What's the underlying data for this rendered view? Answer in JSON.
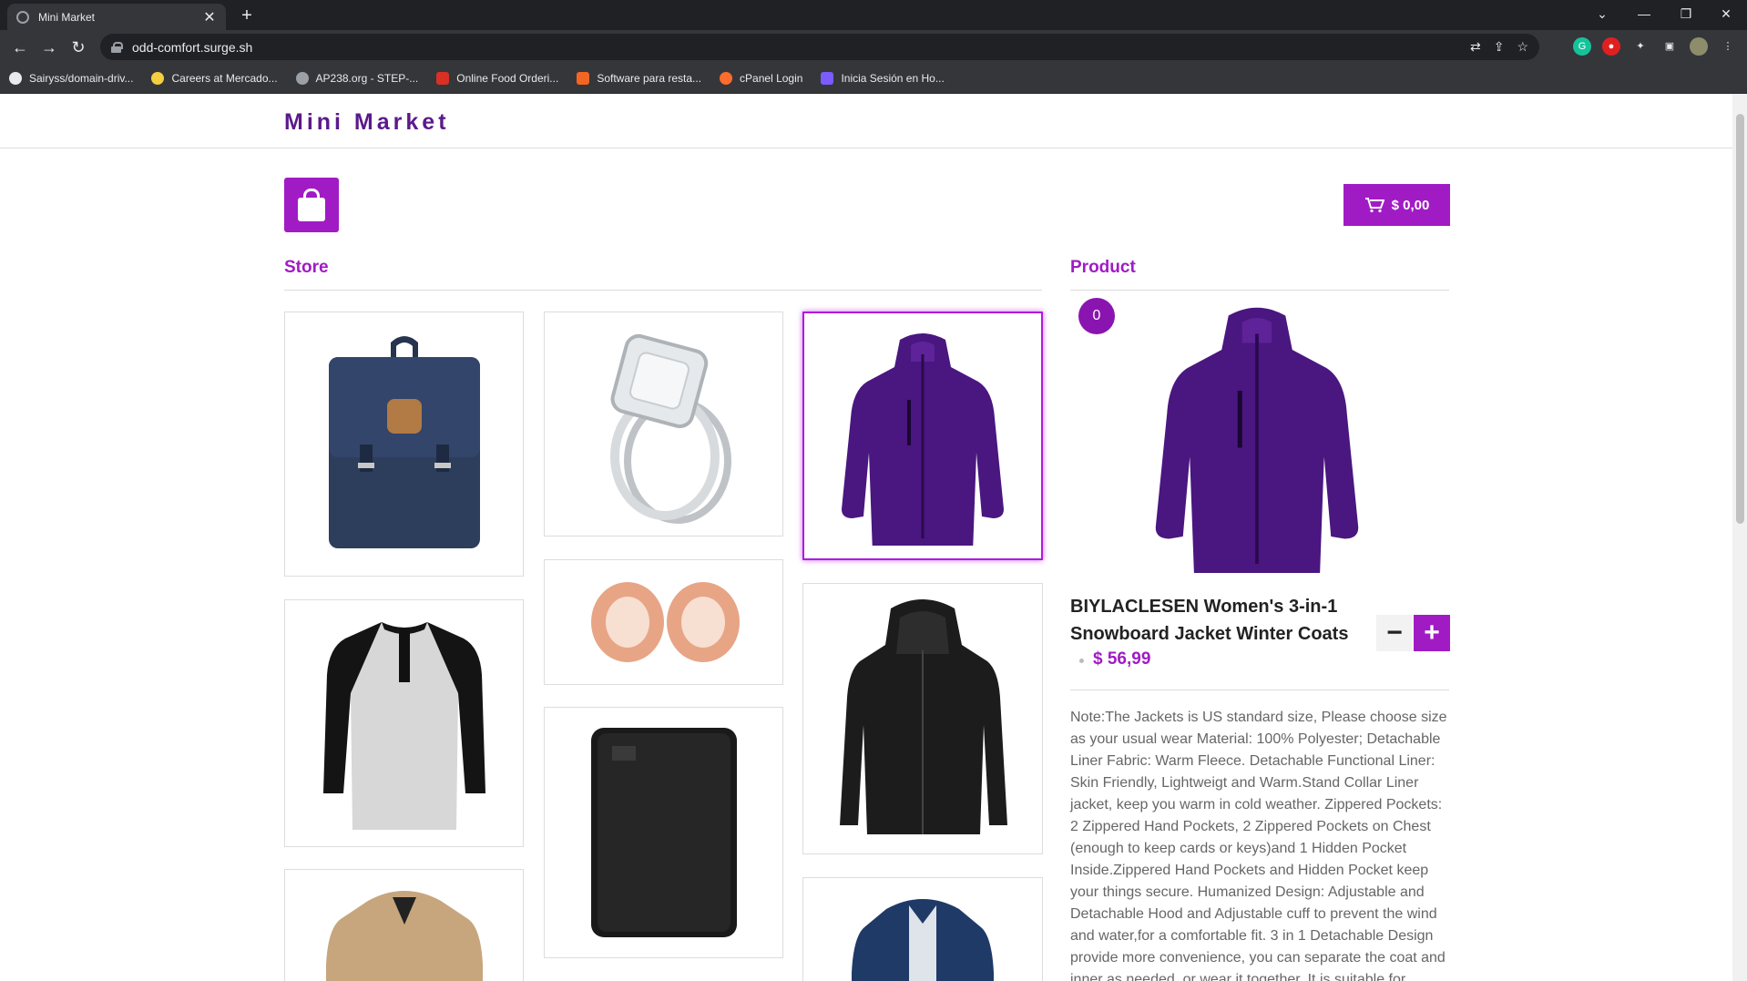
{
  "browser": {
    "tab_title": "Mini Market",
    "url": "odd-comfort.surge.sh",
    "bookmarks": [
      {
        "label": "Sairyss/domain-driv...",
        "color": "#e8eaed"
      },
      {
        "label": "Careers at Mercado...",
        "color": "#f4d03f"
      },
      {
        "label": "AP238.org - STEP-...",
        "color": "#9aa0a6"
      },
      {
        "label": "Online Food Orderi...",
        "color": "#d93025"
      },
      {
        "label": "Software para resta...",
        "color": "#f26522"
      },
      {
        "label": "cPanel Login",
        "color": "#ff6c2c"
      },
      {
        "label": "Inicia Sesión en Ho...",
        "color": "#7b5cff"
      }
    ]
  },
  "header": {
    "brand": "Mini Market"
  },
  "cart": {
    "total": "$ 0,00"
  },
  "store": {
    "title": "Store"
  },
  "product": {
    "title": "Product",
    "count": "0",
    "name": "BIYLACLESEN Women's 3-in-1 Snowboard Jacket Winter Coats",
    "price": "$ 56,99",
    "minus_label": "−",
    "plus_label": "+",
    "description": "Note:The Jackets is US standard size, Please choose size as your usual wear Material: 100% Polyester; Detachable Liner Fabric: Warm Fleece. Detachable Functional Liner: Skin Friendly, Lightweigt and Warm.Stand Collar Liner jacket, keep you warm in cold weather. Zippered Pockets: 2 Zippered Hand Pockets, 2 Zippered Pockets on Chest (enough to keep cards or keys)and 1 Hidden Pocket Inside.Zippered Hand Pockets and Hidden Pocket keep your things secure. Humanized Design: Adjustable and Detachable Hood and Adjustable cuff to prevent the wind and water,for a comfortable fit. 3 in 1 Detachable Design provide more convenience, you can separate the coat and inner as needed, or wear it together. It is suitable for"
  },
  "colors": {
    "accent": "#a11bc4",
    "brand": "#5b1a8c"
  }
}
